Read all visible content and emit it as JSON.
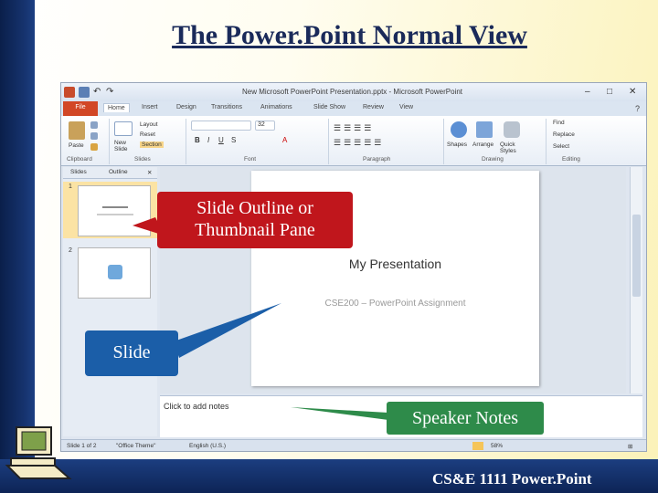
{
  "slide": {
    "title": "The Power.Point Normal View",
    "footer": "CS&E 1111 Power.Point"
  },
  "window": {
    "title": "Microsoft PowerPoint - New Microsoft PowerPoint Presentation.pptx",
    "title_display": "New Microsoft PowerPoint Presentation.pptx - Microsoft PowerPoint",
    "controls": [
      "–",
      "□",
      "✕"
    ]
  },
  "ribbon": {
    "tabs": [
      "File",
      "Home",
      "Insert",
      "Design",
      "Transitions",
      "Animations",
      "Slide Show",
      "Review",
      "View"
    ],
    "groups": [
      "Clipboard",
      "Slides",
      "Font",
      "Paragraph",
      "Drawing",
      "Editing"
    ],
    "buttons": {
      "paste": "Paste",
      "new_slide": "New Slide",
      "layout": "Layout",
      "reset": "Reset",
      "section": "Section",
      "shapes": "Shapes",
      "arrange": "Arrange",
      "quick_styles": "Quick Styles",
      "find": "Find",
      "replace": "Replace",
      "select": "Select"
    },
    "font_size": "32",
    "accent_file": "#d24726"
  },
  "left_pane": {
    "tabs": [
      "Slides",
      "Outline"
    ],
    "close": "✕",
    "thumbnails": [
      {
        "number": "1"
      },
      {
        "number": "2"
      }
    ]
  },
  "canvas": {
    "title": "My Presentation",
    "subtitle": "CSE200 – PowerPoint Assignment"
  },
  "notes": {
    "placeholder": "Click to add notes"
  },
  "statusbar": {
    "slide_info": "Slide 1 of 2",
    "theme": "\"Office Theme\"",
    "language": "English (U.S.)",
    "zoom": "58%"
  },
  "callouts": {
    "outline": "Slide Outline or Thumbnail Pane",
    "slide": "Slide",
    "notes": "Speaker Notes"
  }
}
